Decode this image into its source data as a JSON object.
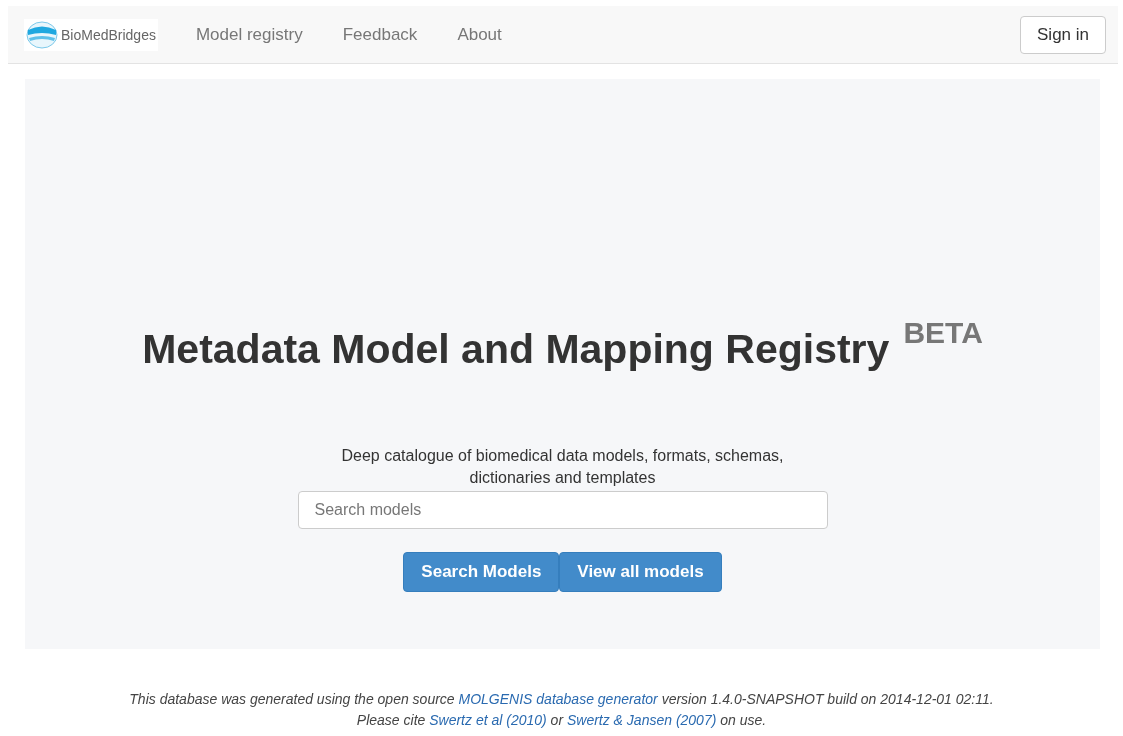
{
  "navbar": {
    "logo_text": "BioMedBridges",
    "items": [
      {
        "label": "Model registry"
      },
      {
        "label": "Feedback"
      },
      {
        "label": "About"
      }
    ],
    "sign_in": "Sign in"
  },
  "hero": {
    "title": "Metadata Model and Mapping Registry",
    "badge": "BETA",
    "subtitle": "Deep catalogue of biomedical data models, formats, schemas, dictionaries and templates",
    "search": {
      "placeholder": "Search models"
    },
    "buttons": [
      "Search Models",
      "View all models"
    ]
  },
  "footer": {
    "lines": [
      [
        {
          "kind": "text",
          "text": "This database was generated using the open source "
        },
        {
          "kind": "link",
          "text": "MOLGENIS database generator"
        },
        {
          "kind": "text",
          "text": " version 1.4.0-SNAPSHOT build on 2014-12-01 02:11."
        }
      ],
      [
        {
          "kind": "text",
          "text": "Please cite "
        },
        {
          "kind": "link",
          "text": "Swertz et al (2010)"
        },
        {
          "kind": "text",
          "text": " or "
        },
        {
          "kind": "link",
          "text": "Swertz & Jansen (2007)"
        },
        {
          "kind": "text",
          "text": " on use."
        }
      ]
    ]
  }
}
